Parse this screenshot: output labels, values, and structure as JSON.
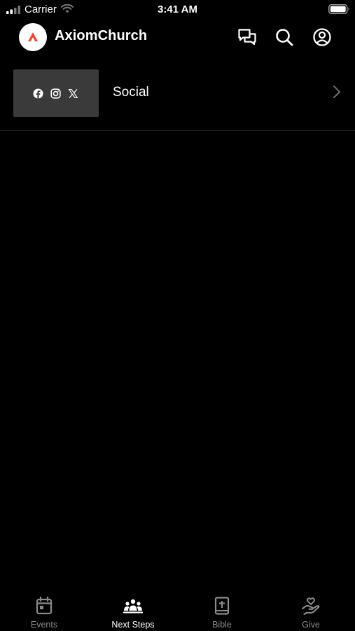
{
  "status_bar": {
    "carrier": "Carrier",
    "time": "3:41 AM"
  },
  "header": {
    "title": "AxiomChurch",
    "logo_icon": "axiom-logo-icon",
    "actions": [
      "chat-icon",
      "search-icon",
      "account-icon"
    ]
  },
  "list": {
    "items": [
      {
        "label": "Social",
        "thumbnail_icons": [
          "facebook-icon",
          "instagram-icon",
          "x-icon"
        ]
      }
    ]
  },
  "tabbar": {
    "tabs": [
      {
        "label": "Events",
        "icon": "calendar-icon",
        "active": false
      },
      {
        "label": "Next Steps",
        "icon": "people-icon",
        "active": true
      },
      {
        "label": "Bible",
        "icon": "bible-icon",
        "active": false
      },
      {
        "label": "Give",
        "icon": "give-icon",
        "active": false
      }
    ]
  },
  "colors": {
    "background": "#000000",
    "thumbnail_bg": "#3a3a3a",
    "inactive_tab": "#8a8a8a",
    "logo_accent": "#e8483a"
  }
}
